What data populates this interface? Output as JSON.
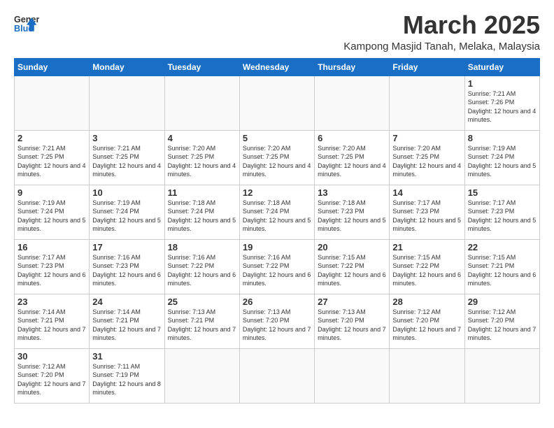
{
  "logo": {
    "line1": "General",
    "line2": "Blue"
  },
  "header": {
    "month_year": "March 2025",
    "location": "Kampong Masjid Tanah, Melaka, Malaysia"
  },
  "weekdays": [
    "Sunday",
    "Monday",
    "Tuesday",
    "Wednesday",
    "Thursday",
    "Friday",
    "Saturday"
  ],
  "weeks": [
    [
      {
        "day": "",
        "info": ""
      },
      {
        "day": "",
        "info": ""
      },
      {
        "day": "",
        "info": ""
      },
      {
        "day": "",
        "info": ""
      },
      {
        "day": "",
        "info": ""
      },
      {
        "day": "",
        "info": ""
      },
      {
        "day": "1",
        "info": "Sunrise: 7:21 AM\nSunset: 7:26 PM\nDaylight: 12 hours and 4 minutes."
      }
    ],
    [
      {
        "day": "2",
        "info": "Sunrise: 7:21 AM\nSunset: 7:25 PM\nDaylight: 12 hours and 4 minutes."
      },
      {
        "day": "3",
        "info": "Sunrise: 7:21 AM\nSunset: 7:25 PM\nDaylight: 12 hours and 4 minutes."
      },
      {
        "day": "4",
        "info": "Sunrise: 7:20 AM\nSunset: 7:25 PM\nDaylight: 12 hours and 4 minutes."
      },
      {
        "day": "5",
        "info": "Sunrise: 7:20 AM\nSunset: 7:25 PM\nDaylight: 12 hours and 4 minutes."
      },
      {
        "day": "6",
        "info": "Sunrise: 7:20 AM\nSunset: 7:25 PM\nDaylight: 12 hours and 4 minutes."
      },
      {
        "day": "7",
        "info": "Sunrise: 7:20 AM\nSunset: 7:25 PM\nDaylight: 12 hours and 4 minutes."
      },
      {
        "day": "8",
        "info": "Sunrise: 7:19 AM\nSunset: 7:24 PM\nDaylight: 12 hours and 5 minutes."
      }
    ],
    [
      {
        "day": "9",
        "info": "Sunrise: 7:19 AM\nSunset: 7:24 PM\nDaylight: 12 hours and 5 minutes."
      },
      {
        "day": "10",
        "info": "Sunrise: 7:19 AM\nSunset: 7:24 PM\nDaylight: 12 hours and 5 minutes."
      },
      {
        "day": "11",
        "info": "Sunrise: 7:18 AM\nSunset: 7:24 PM\nDaylight: 12 hours and 5 minutes."
      },
      {
        "day": "12",
        "info": "Sunrise: 7:18 AM\nSunset: 7:24 PM\nDaylight: 12 hours and 5 minutes."
      },
      {
        "day": "13",
        "info": "Sunrise: 7:18 AM\nSunset: 7:23 PM\nDaylight: 12 hours and 5 minutes."
      },
      {
        "day": "14",
        "info": "Sunrise: 7:17 AM\nSunset: 7:23 PM\nDaylight: 12 hours and 5 minutes."
      },
      {
        "day": "15",
        "info": "Sunrise: 7:17 AM\nSunset: 7:23 PM\nDaylight: 12 hours and 5 minutes."
      }
    ],
    [
      {
        "day": "16",
        "info": "Sunrise: 7:17 AM\nSunset: 7:23 PM\nDaylight: 12 hours and 6 minutes."
      },
      {
        "day": "17",
        "info": "Sunrise: 7:16 AM\nSunset: 7:23 PM\nDaylight: 12 hours and 6 minutes."
      },
      {
        "day": "18",
        "info": "Sunrise: 7:16 AM\nSunset: 7:22 PM\nDaylight: 12 hours and 6 minutes."
      },
      {
        "day": "19",
        "info": "Sunrise: 7:16 AM\nSunset: 7:22 PM\nDaylight: 12 hours and 6 minutes."
      },
      {
        "day": "20",
        "info": "Sunrise: 7:15 AM\nSunset: 7:22 PM\nDaylight: 12 hours and 6 minutes."
      },
      {
        "day": "21",
        "info": "Sunrise: 7:15 AM\nSunset: 7:22 PM\nDaylight: 12 hours and 6 minutes."
      },
      {
        "day": "22",
        "info": "Sunrise: 7:15 AM\nSunset: 7:21 PM\nDaylight: 12 hours and 6 minutes."
      }
    ],
    [
      {
        "day": "23",
        "info": "Sunrise: 7:14 AM\nSunset: 7:21 PM\nDaylight: 12 hours and 7 minutes."
      },
      {
        "day": "24",
        "info": "Sunrise: 7:14 AM\nSunset: 7:21 PM\nDaylight: 12 hours and 7 minutes."
      },
      {
        "day": "25",
        "info": "Sunrise: 7:13 AM\nSunset: 7:21 PM\nDaylight: 12 hours and 7 minutes."
      },
      {
        "day": "26",
        "info": "Sunrise: 7:13 AM\nSunset: 7:20 PM\nDaylight: 12 hours and 7 minutes."
      },
      {
        "day": "27",
        "info": "Sunrise: 7:13 AM\nSunset: 7:20 PM\nDaylight: 12 hours and 7 minutes."
      },
      {
        "day": "28",
        "info": "Sunrise: 7:12 AM\nSunset: 7:20 PM\nDaylight: 12 hours and 7 minutes."
      },
      {
        "day": "29",
        "info": "Sunrise: 7:12 AM\nSunset: 7:20 PM\nDaylight: 12 hours and 7 minutes."
      }
    ],
    [
      {
        "day": "30",
        "info": "Sunrise: 7:12 AM\nSunset: 7:20 PM\nDaylight: 12 hours and 7 minutes."
      },
      {
        "day": "31",
        "info": "Sunrise: 7:11 AM\nSunset: 7:19 PM\nDaylight: 12 hours and 8 minutes."
      },
      {
        "day": "",
        "info": ""
      },
      {
        "day": "",
        "info": ""
      },
      {
        "day": "",
        "info": ""
      },
      {
        "day": "",
        "info": ""
      },
      {
        "day": "",
        "info": ""
      }
    ]
  ]
}
